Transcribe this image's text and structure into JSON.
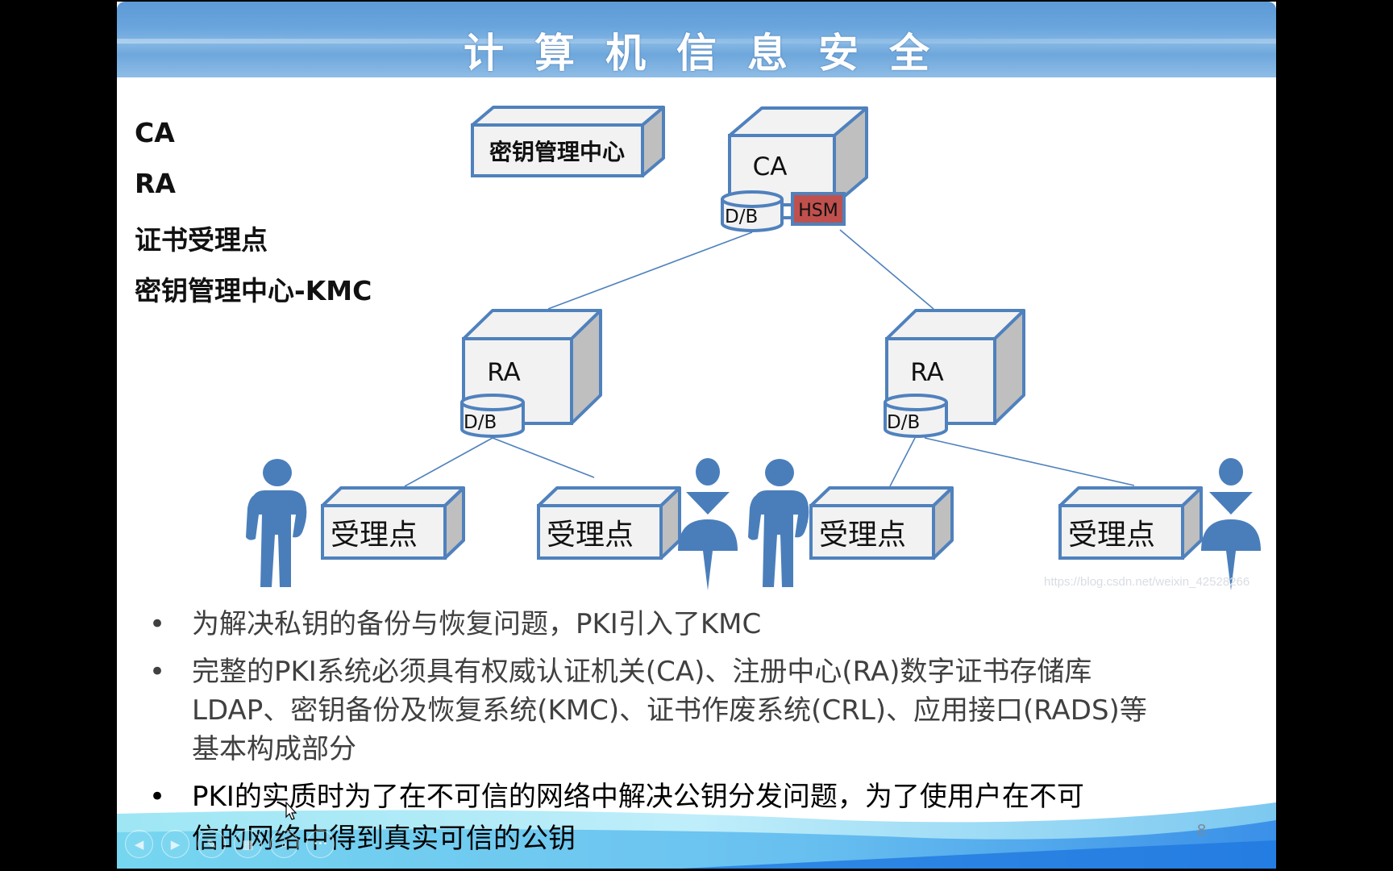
{
  "slide": {
    "title": "计算机信息安全",
    "page_number": "8",
    "watermark": "https://blog.csdn.net/weixin_42528266",
    "terms": [
      "CA",
      "RA",
      "证书受理点",
      "密钥管理中心-KMC"
    ],
    "diagram": {
      "kmc_box": "密钥管理中心",
      "ca_box": "CA",
      "ca_db": "D/B",
      "ca_hsm": "HSM",
      "ra_left": "RA",
      "ra_left_db": "D/B",
      "ra_right": "RA",
      "ra_right_db": "D/B",
      "acceptance_points": [
        "受理点",
        "受理点",
        "受理点",
        "受理点"
      ]
    },
    "bullets": [
      {
        "text": "为解决私钥的备份与恢复问题，PKI引入了KMC"
      },
      {
        "line1": "完整的PKI系统必须具有权威认证机关(CA)、注册中心(RA)数字证书存储库",
        "line2": "LDAP、密钥备份及恢复系统(KMC)、证书作废系统(CRL)、应用接口(RADS)等",
        "line3": "基本构成部分"
      },
      {
        "line1": "PKI的实质时为了在不可信的网络中解决公钥分发问题，为了使用户在不可",
        "line2": "信的网络中得到真实可信的公钥"
      }
    ],
    "bullet_glyph": "•",
    "colors": {
      "box_stroke": "#4f81bd",
      "box_face": "#f2f2f2",
      "box_side": "#bfbfbf",
      "hsm_fill": "#c0504d",
      "person": "#4a7ebb",
      "bullet_gray": "#404040",
      "bullet_black": "#000000"
    }
  },
  "toolbar": {
    "prev_icon": "◀",
    "next_icon": "▶",
    "pen_icon": "✎",
    "slides_icon": "▦",
    "zoom_icon": "⌕",
    "more_icon": "•••"
  }
}
